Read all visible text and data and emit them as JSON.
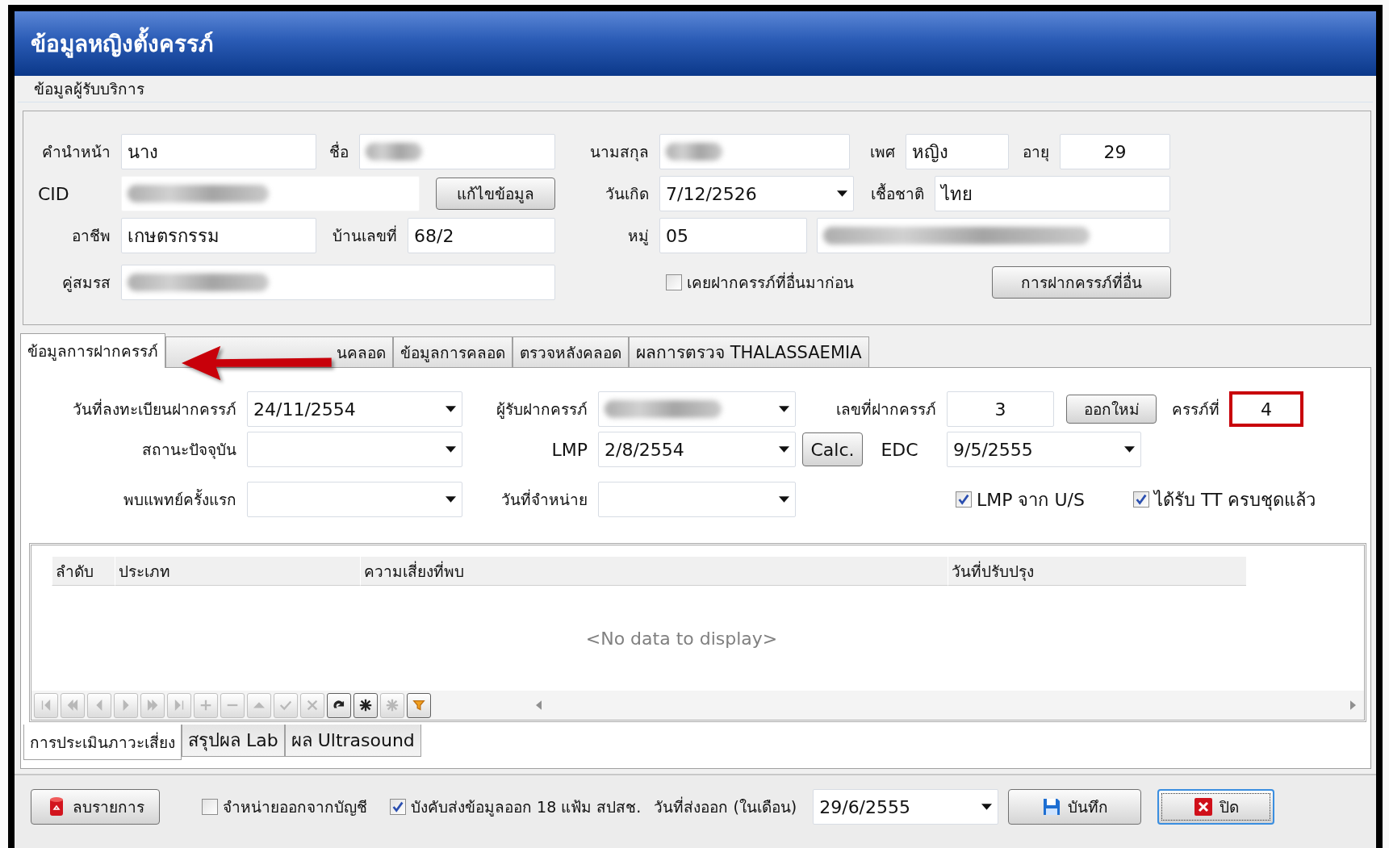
{
  "window": {
    "title": "ข้อมูลหญิงตั้งครรภ์"
  },
  "client_info": {
    "legend": "ข้อมูลผู้รับบริการ",
    "prefix": {
      "label": "คำนำหน้า",
      "value": "นาง"
    },
    "first_name": {
      "label": "ชื่อ",
      "redacted": true
    },
    "last_name": {
      "label": "นามสกุล",
      "redacted": true
    },
    "sex": {
      "label": "เพศ",
      "value": "หญิง"
    },
    "age": {
      "label": "อายุ",
      "value": "29"
    },
    "cid": {
      "label": "CID",
      "redacted": true
    },
    "edit_button": "แก้ไขข้อมูล",
    "birth_date": {
      "label": "วันเกิด",
      "value": "7/12/2526"
    },
    "nationality": {
      "label": "เชื้อชาติ",
      "value": "ไทย"
    },
    "occupation": {
      "label": "อาชีพ",
      "value": "เกษตรกรรม"
    },
    "house_no": {
      "label": "บ้านเลขที่",
      "value": "68/2"
    },
    "village": {
      "label": "หมู่",
      "value": "05"
    },
    "address": {
      "redacted": true
    },
    "spouse": {
      "label": "คู่สมรส",
      "redacted": true
    },
    "prior_anc_elsewhere": {
      "label": "เคยฝากครรภ์ที่อื่นมาก่อน",
      "checked": false
    },
    "other_anc_button": "การฝากครรภ์ที่อื่น"
  },
  "tabs": [
    {
      "label": "ข้อมูลการฝากครรภ์",
      "selected": true
    },
    {
      "label": "นคลอด",
      "selected": false
    },
    {
      "label": "ข้อมูลการคลอด",
      "selected": false
    },
    {
      "label": "ตรวจหลังคลอด",
      "selected": false
    },
    {
      "label": "ผลการตรวจ THALASSAEMIA",
      "selected": false
    }
  ],
  "anc": {
    "registration_date": {
      "label": "วันที่ลงทะเบียนฝากครรภ์",
      "value": "24/11/2554"
    },
    "receiver": {
      "label": "ผู้รับฝากครรภ์",
      "redacted": true
    },
    "anc_no": {
      "label": "เลขที่ฝากครรภ์",
      "value": "3"
    },
    "new_button": "ออกใหม่",
    "gravida": {
      "label": "ครรภ์ที่",
      "value": "4",
      "highlighted": true
    },
    "status": {
      "label": "สถานะปัจจุบัน"
    },
    "lmp": {
      "label": "LMP",
      "value": "2/8/2554"
    },
    "calc_button": "Calc.",
    "edc": {
      "label": "EDC",
      "value": "9/5/2555"
    },
    "first_visit": {
      "label": "พบแพทย์ครั้งแรก"
    },
    "discharge_date": {
      "label": "วันที่จำหน่าย"
    },
    "lmp_from_us": {
      "label": "LMP จาก U/S",
      "checked": true
    },
    "tt_complete": {
      "label": "ได้รับ TT ครบชุดแล้ว",
      "checked": true
    }
  },
  "risk_table": {
    "columns": [
      "ลำดับ",
      "ประเภท",
      "ความเสี่ยงที่พบ",
      "วันที่ปรับปรุง"
    ],
    "empty_text": "<No data to display>",
    "navigator": [
      {
        "kind": "first",
        "disabled": true
      },
      {
        "kind": "prev_page",
        "disabled": true
      },
      {
        "kind": "prev",
        "disabled": true
      },
      {
        "kind": "next",
        "disabled": true
      },
      {
        "kind": "next_page",
        "disabled": true
      },
      {
        "kind": "last",
        "disabled": true
      },
      {
        "kind": "add",
        "disabled": true
      },
      {
        "kind": "remove",
        "disabled": true
      },
      {
        "kind": "up",
        "disabled": true
      },
      {
        "kind": "confirm",
        "disabled": true
      },
      {
        "kind": "cancel",
        "disabled": true
      },
      {
        "kind": "refresh",
        "disabled": false
      },
      {
        "kind": "star",
        "disabled": false
      },
      {
        "kind": "star",
        "disabled": true
      },
      {
        "kind": "filter",
        "disabled": false
      }
    ]
  },
  "sub_tabs": [
    {
      "label": "การประเมินภาวะเสี่ยง",
      "selected": true
    },
    {
      "label": "สรุปผล Lab",
      "selected": false
    },
    {
      "label": "ผล Ultrasound",
      "selected": false
    }
  ],
  "footer": {
    "delete_button": "ลบรายการ",
    "discharge": {
      "label": "จำหน่ายออกจากบัญชี",
      "checked": false
    },
    "force_export": {
      "label": "บังคับส่งข้อมูลออก 18 แฟ้ม สปสช.",
      "checked": true
    },
    "export_date": {
      "label": "วันที่ส่งออก (ในเดือน)",
      "value": "29/6/2555"
    },
    "save_button": "บันทึก",
    "close_button": "ปิด"
  }
}
